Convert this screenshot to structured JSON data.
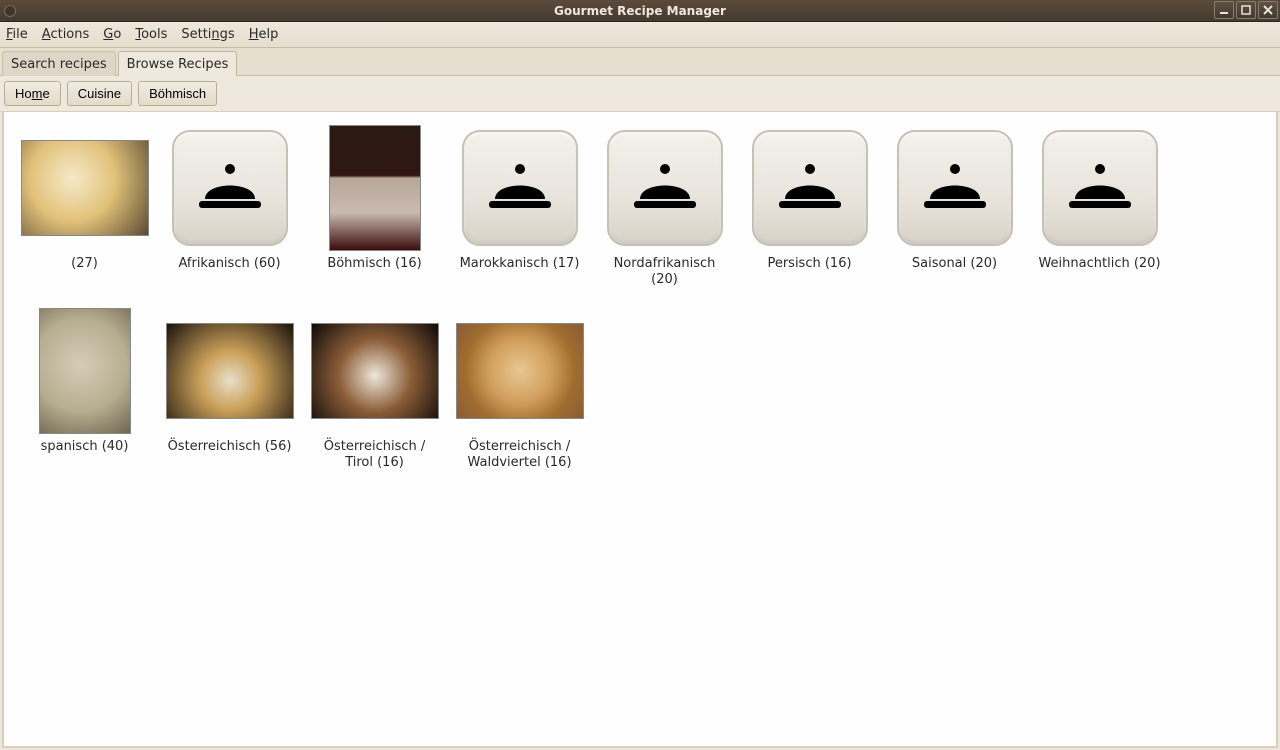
{
  "window": {
    "title": "Gourmet Recipe Manager"
  },
  "menu": {
    "file": "File",
    "actions": "Actions",
    "go": "Go",
    "tools": "Tools",
    "settings": "Settings",
    "help": "Help"
  },
  "tabs": {
    "search": "Search recipes",
    "browse": "Browse Recipes"
  },
  "breadcrumb": {
    "home": "Home",
    "cuisine": "Cuisine",
    "bohmisch": "Böhmisch"
  },
  "categories": [
    {
      "label": "(27)",
      "kind": "photo",
      "photoClass": "ph-pasta"
    },
    {
      "label": "Afrikanisch (60)",
      "kind": "default"
    },
    {
      "label": "Böhmisch (16)",
      "kind": "photo",
      "photoClass": "ph-jam",
      "tall": true
    },
    {
      "label": "Marokkanisch (17)",
      "kind": "default"
    },
    {
      "label": "Nordafrikanisch (20)",
      "kind": "default"
    },
    {
      "label": "Persisch (16)",
      "kind": "default"
    },
    {
      "label": "Saisonal (20)",
      "kind": "default"
    },
    {
      "label": "Weihnachtlich (20)",
      "kind": "default"
    },
    {
      "label": "spanisch (40)",
      "kind": "photo",
      "photoClass": "ph-dumpl",
      "tall": true
    },
    {
      "label": "Österreichisch (56)",
      "kind": "photo",
      "photoClass": "ph-cake1"
    },
    {
      "label": "Österreichisch / Tirol (16)",
      "kind": "photo",
      "photoClass": "ph-cake2"
    },
    {
      "label": "Österreichisch / Waldviertel (16)",
      "kind": "photo",
      "photoClass": "ph-cook"
    }
  ]
}
